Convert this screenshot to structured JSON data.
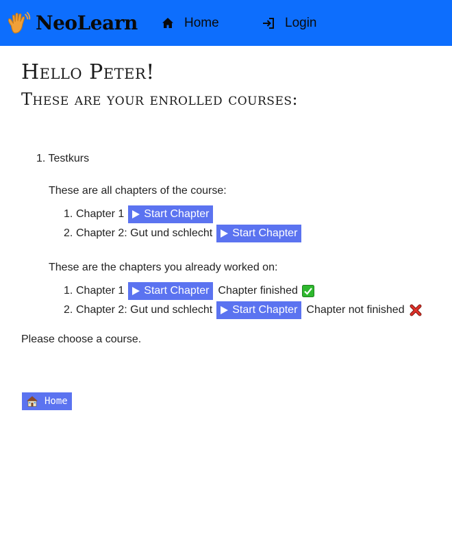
{
  "navbar": {
    "brand": "NeoLearn",
    "brand_icon": "hand-wave-icon",
    "links": [
      {
        "label": "Home",
        "icon": "home-icon"
      },
      {
        "label": "Login",
        "icon": "login-icon"
      }
    ],
    "background": "#0d6efd"
  },
  "main": {
    "greeting": "Hello Peter!",
    "subheading": "These are your enrolled courses:",
    "courses": [
      {
        "number": "1.",
        "name": "Testkurs",
        "all_chapters_label": "These are all chapters of the course:",
        "all_chapters": [
          {
            "number": "1.",
            "title": "Chapter 1",
            "button": "Start Chapter"
          },
          {
            "number": "2.",
            "title": "Chapter 2: Gut und schlecht",
            "button": "Start Chapter"
          }
        ],
        "worked_chapters_label": "These are the chapters you already worked on:",
        "worked_chapters": [
          {
            "number": "1.",
            "title": "Chapter 1",
            "button": "Start Chapter",
            "status": "Chapter finished",
            "status_icon": "check-mark-icon"
          },
          {
            "number": "2.",
            "title": "Chapter 2: Gut und schlecht",
            "button": "Start Chapter",
            "status": "Chapter not finished",
            "status_icon": "cross-mark-icon"
          }
        ]
      }
    ],
    "choose_prompt": "Please choose a course."
  },
  "footer": {
    "home_button": "Home",
    "home_icon": "house-icon"
  },
  "colors": {
    "accent": "#5b73f0",
    "nav": "#0d6efd",
    "check": "#2eb82e",
    "cross": "#e0302a"
  }
}
